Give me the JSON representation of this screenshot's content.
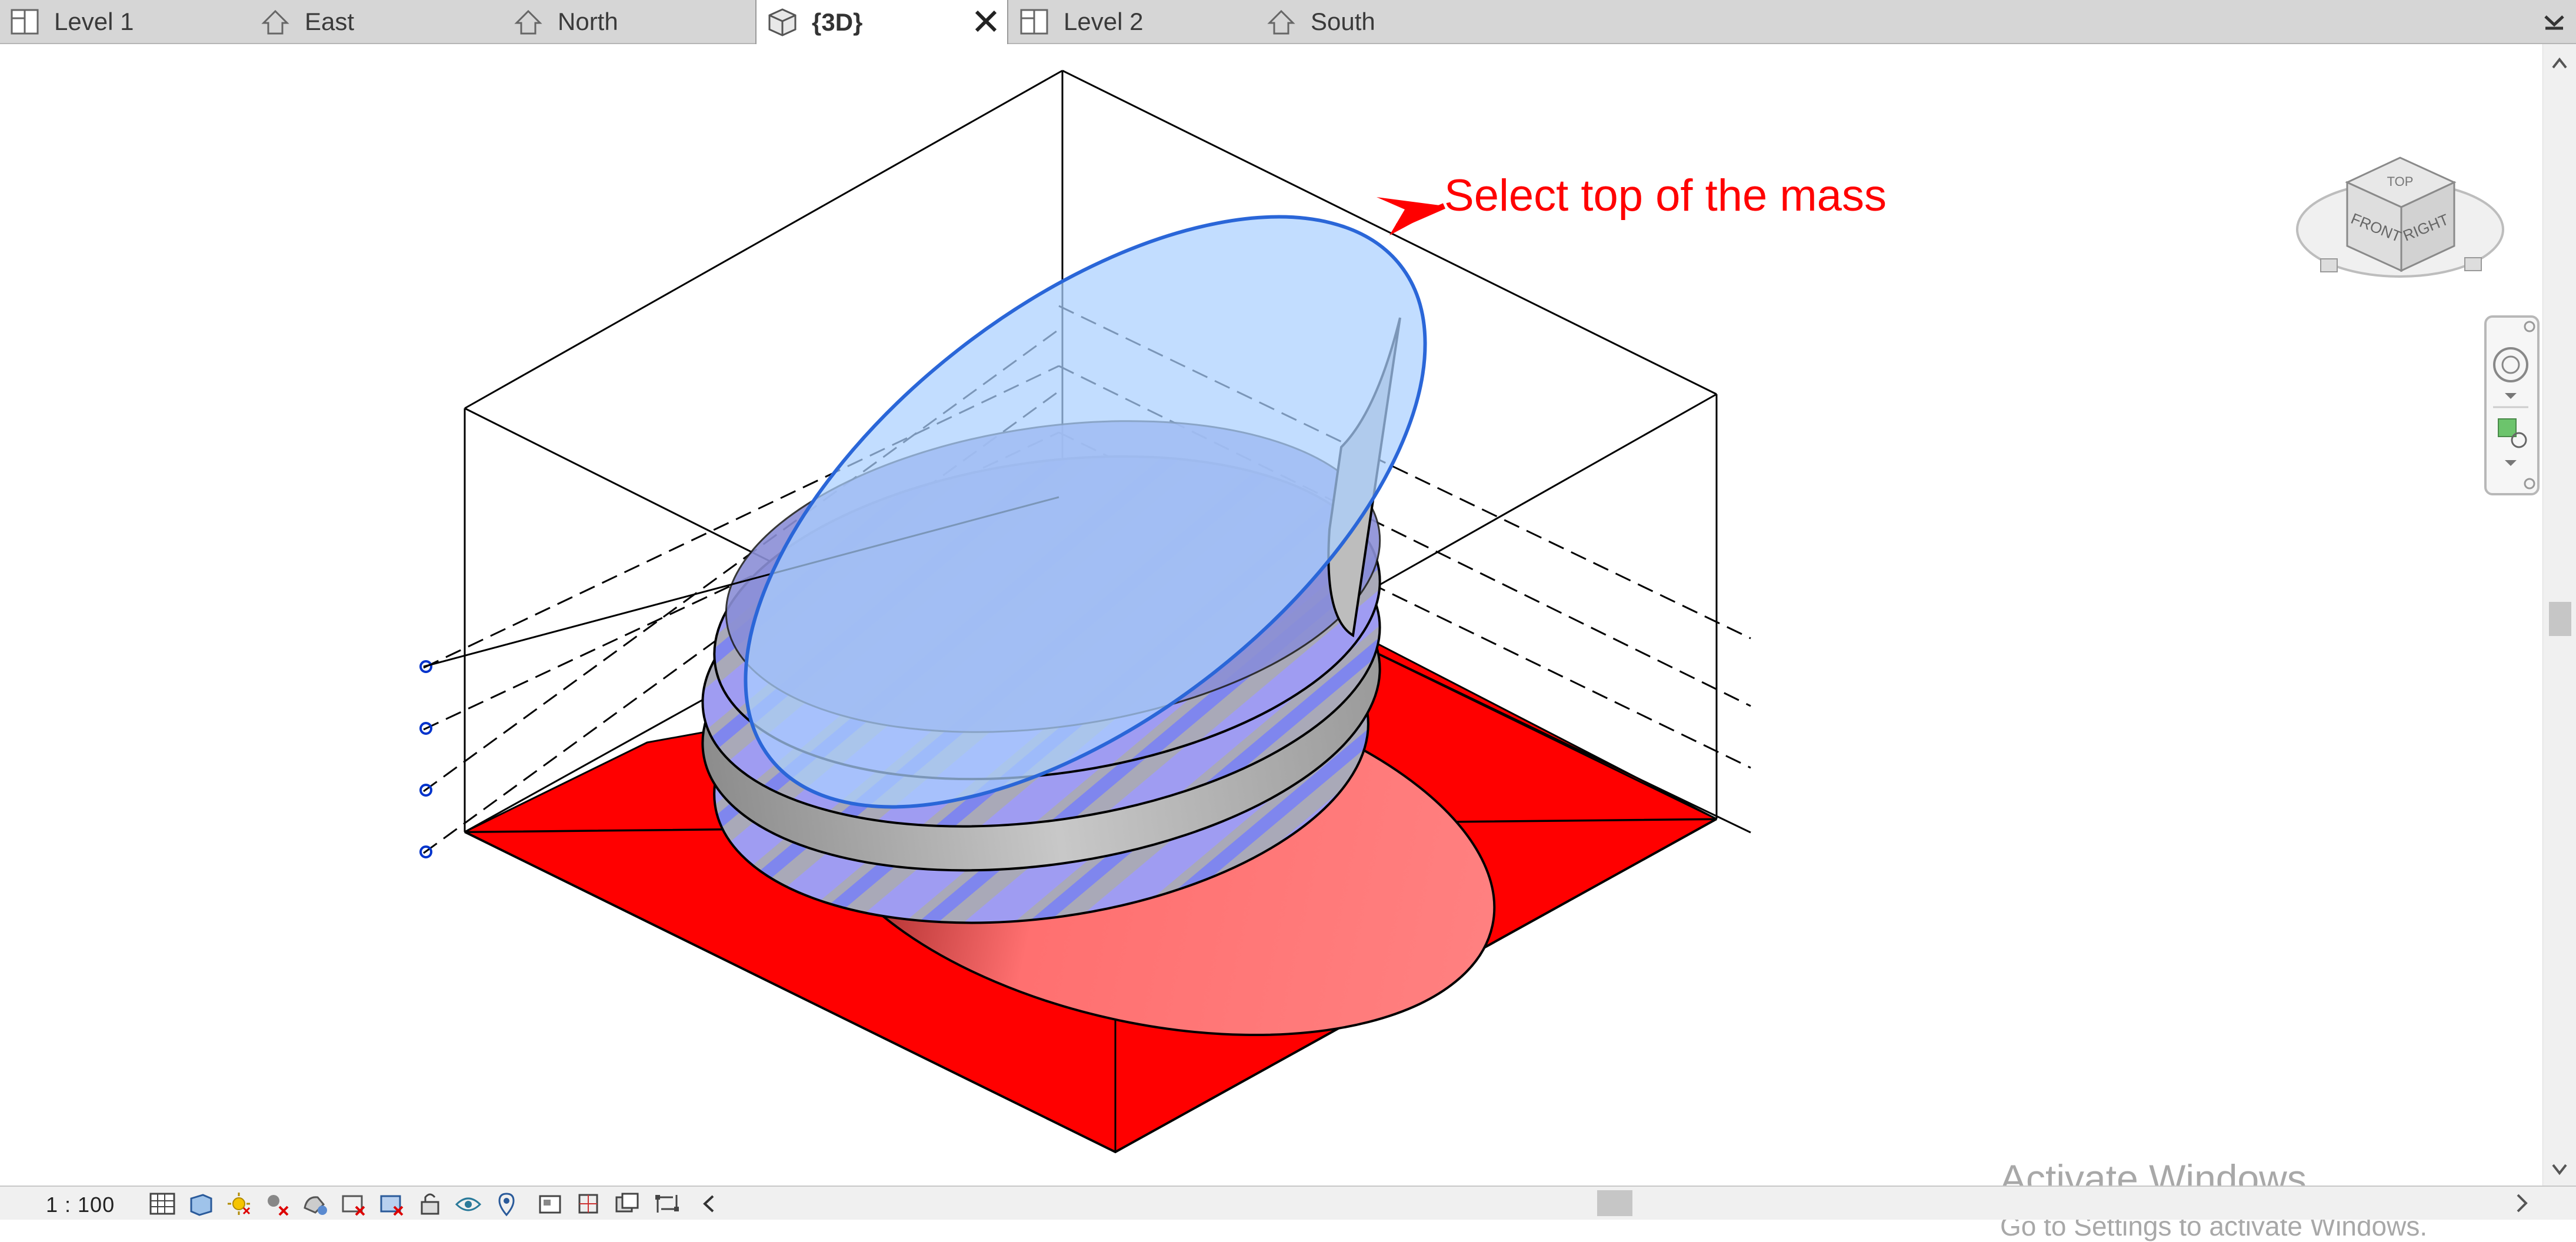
{
  "tabs": [
    {
      "label": "Level 1",
      "icon": "plan-view-icon",
      "active": false
    },
    {
      "label": "East",
      "icon": "elevation-view-icon",
      "active": false
    },
    {
      "label": "North",
      "icon": "elevation-view-icon",
      "active": false
    },
    {
      "label": "{3D}",
      "icon": "3d-view-icon",
      "active": true
    },
    {
      "label": "Level 2",
      "icon": "plan-view-icon",
      "active": false
    },
    {
      "label": "South",
      "icon": "elevation-view-icon",
      "active": false
    }
  ],
  "viewport": {
    "annotation": "Select top of the mass",
    "annotation_color": "#ff0000",
    "mass_top_color": "#aad0ff",
    "floor_color": "#ff0000",
    "viewcube": {
      "top_face": "TOP",
      "front_face": "FRONT",
      "right_face": "RIGHT"
    }
  },
  "status_bar": {
    "scale": "1 : 100",
    "tool_icons": [
      "detail-level-icon",
      "visual-style-icon",
      "sun-path-icon",
      "shadows-icon",
      "show-rendering-icon",
      "crop-view-icon",
      "show-crop-region-icon",
      "unlock-3d-view-icon",
      "temporary-hide-icon",
      "reveal-hidden-icon",
      "temporary-view-properties-icon",
      "hide-analytical-model-icon",
      "highlight-displacement-icon"
    ]
  },
  "watermark": {
    "title": "Activate Windows",
    "subtitle": "Go to Settings to activate Windows."
  }
}
